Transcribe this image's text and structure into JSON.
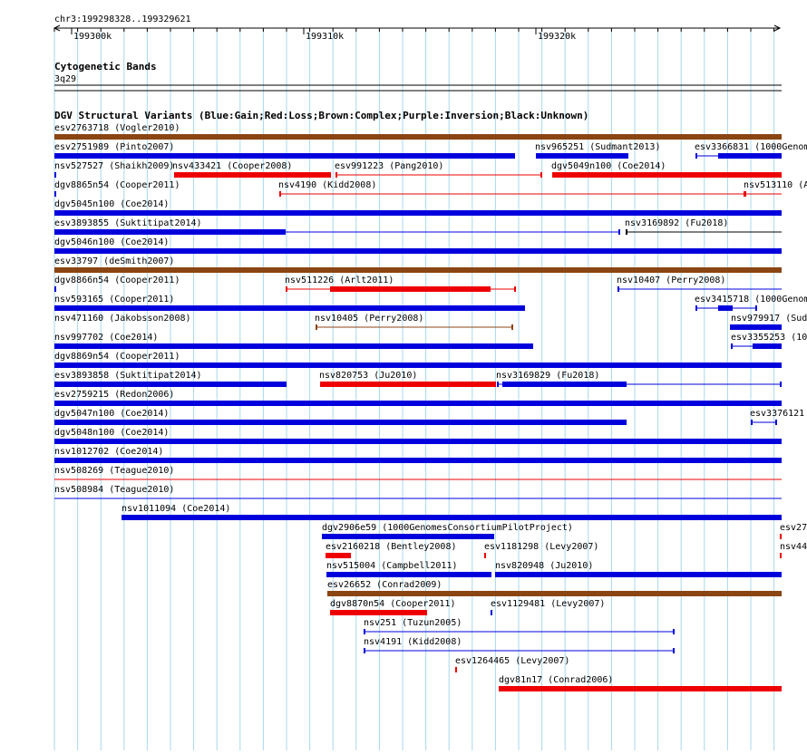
{
  "ruler": {
    "region_label": "chr3:199298328..199329621",
    "ticks": [
      "199300k",
      "199310k",
      "199320k"
    ]
  },
  "cytoband_track": {
    "title": "Cytogenetic Bands",
    "band": "3q29"
  },
  "dgv_track": {
    "title": "DGV Structural Variants (Blue:Gain;Red:Loss;Brown:Complex;Purple:Inversion;Black:Unknown)"
  },
  "colors": {
    "gain": "#0000dd",
    "loss": "#ee0000",
    "complex": "#8b4513",
    "inversion": "#800080",
    "unknown": "#000000",
    "gridline": "#a9d7ee"
  },
  "features": [
    {
      "id": "esv2763718",
      "label": "esv2763718 (Vogler2010)",
      "type": "complex"
    },
    {
      "id": "esv2751989",
      "label": "esv2751989 (Pinto2007)",
      "type": "gain"
    },
    {
      "id": "nsv965251",
      "label": "nsv965251 (Sudmant2013)",
      "type": "gain"
    },
    {
      "id": "esv3366831",
      "label": "esv3366831 (1000Genom",
      "type": "gain"
    },
    {
      "id": "nsv527527",
      "label": "nsv527527 (Shaikh2009)",
      "type": "gain"
    },
    {
      "id": "nsv433421",
      "label": "nsv433421 (Cooper2008)",
      "type": "loss"
    },
    {
      "id": "esv991223",
      "label": "esv991223 (Pang2010)",
      "type": "loss"
    },
    {
      "id": "dgv5049n100",
      "label": "dgv5049n100 (Coe2014)",
      "type": "loss"
    },
    {
      "id": "dgv8865n54",
      "label": "dgv8865n54 (Cooper2011)",
      "type": "gain"
    },
    {
      "id": "nsv4190",
      "label": "nsv4190 (Kidd2008)",
      "type": "loss"
    },
    {
      "id": "nsv513110",
      "label": "nsv513110 (A",
      "type": "loss"
    },
    {
      "id": "dgv5045n100",
      "label": "dgv5045n100 (Coe2014)",
      "type": "gain"
    },
    {
      "id": "esv3893855",
      "label": "esv3893855 (Suktitipat2014)",
      "type": "gain"
    },
    {
      "id": "nsv3169892",
      "label": "nsv3169892 (Fu2018)",
      "type": "unknown"
    },
    {
      "id": "dgv5046n100",
      "label": "dgv5046n100 (Coe2014)",
      "type": "gain"
    },
    {
      "id": "esv33797",
      "label": "esv33797 (deSmith2007)",
      "type": "complex"
    },
    {
      "id": "dgv8866n54",
      "label": "dgv8866n54 (Cooper2011)",
      "type": "gain"
    },
    {
      "id": "nsv511226",
      "label": "nsv511226 (Arlt2011)",
      "type": "loss"
    },
    {
      "id": "nsv10407",
      "label": "nsv10407 (Perry2008)",
      "type": "gain"
    },
    {
      "id": "nsv593165",
      "label": "nsv593165 (Cooper2011)",
      "type": "gain"
    },
    {
      "id": "esv3415718",
      "label": "esv3415718 (1000Genom",
      "type": "gain"
    },
    {
      "id": "nsv471160",
      "label": "nsv471160 (Jakobsson2008)",
      "type": "gain"
    },
    {
      "id": "nsv10405",
      "label": "nsv10405 (Perry2008)",
      "type": "complex"
    },
    {
      "id": "nsv979917",
      "label": "nsv979917 (Sud",
      "type": "gain"
    },
    {
      "id": "nsv997702",
      "label": "nsv997702 (Coe2014)",
      "type": "gain"
    },
    {
      "id": "esv3355253",
      "label": "esv3355253 (100",
      "type": "gain"
    },
    {
      "id": "dgv8869n54",
      "label": "dgv8869n54 (Cooper2011)",
      "type": "gain"
    },
    {
      "id": "esv3893858",
      "label": "esv3893858 (Suktitipat2014)",
      "type": "gain"
    },
    {
      "id": "nsv820753",
      "label": "nsv820753 (Ju2010)",
      "type": "loss"
    },
    {
      "id": "nsv3169829",
      "label": "nsv3169829 (Fu2018)",
      "type": "gain"
    },
    {
      "id": "esv2759215",
      "label": "esv2759215 (Redon2006)",
      "type": "gain"
    },
    {
      "id": "dgv5047n100",
      "label": "dgv5047n100 (Coe2014)",
      "type": "gain"
    },
    {
      "id": "esv3376121",
      "label": "esv3376121",
      "type": "gain"
    },
    {
      "id": "dgv5048n100",
      "label": "dgv5048n100 (Coe2014)",
      "type": "gain"
    },
    {
      "id": "nsv1012702",
      "label": "nsv1012702 (Coe2014)",
      "type": "gain"
    },
    {
      "id": "nsv508269",
      "label": "nsv508269 (Teague2010)",
      "type": "loss"
    },
    {
      "id": "nsv508984",
      "label": "nsv508984 (Teague2010)",
      "type": "gain"
    },
    {
      "id": "nsv1011094",
      "label": "nsv1011094 (Coe2014)",
      "type": "gain"
    },
    {
      "id": "dgv2906e59",
      "label": "dgv2906e59 (1000GenomesConsortiumPilotProject)",
      "type": "gain"
    },
    {
      "id": "esv27",
      "label": "esv27",
      "type": "loss"
    },
    {
      "id": "esv2160218",
      "label": "esv2160218 (Bentley2008)",
      "type": "loss"
    },
    {
      "id": "esv1181298",
      "label": "esv1181298 (Levy2007)",
      "type": "loss"
    },
    {
      "id": "nsv44",
      "label": "nsv44",
      "type": "loss"
    },
    {
      "id": "nsv515004",
      "label": "nsv515004 (Campbell2011)",
      "type": "gain"
    },
    {
      "id": "nsv820948",
      "label": "nsv820948 (Ju2010)",
      "type": "gain"
    },
    {
      "id": "esv26652",
      "label": "esv26652 (Conrad2009)",
      "type": "complex"
    },
    {
      "id": "dgv8870n54",
      "label": "dgv8870n54 (Cooper2011)",
      "type": "loss"
    },
    {
      "id": "esv1129481",
      "label": "esv1129481 (Levy2007)",
      "type": "gain"
    },
    {
      "id": "nsv251",
      "label": "nsv251 (Tuzun2005)",
      "type": "gain"
    },
    {
      "id": "nsv4191",
      "label": "nsv4191 (Kidd2008)",
      "type": "gain"
    },
    {
      "id": "esv1264465",
      "label": "esv1264465 (Levy2007)",
      "type": "loss"
    },
    {
      "id": "dgv81n17",
      "label": "dgv81n17 (Conrad2006)",
      "type": "loss"
    }
  ]
}
